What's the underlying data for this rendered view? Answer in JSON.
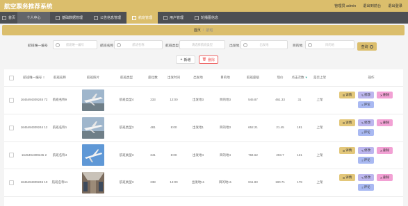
{
  "app": {
    "title": "航空票务推荐系统",
    "user": "管理员 admin",
    "logout": "退出到前台",
    "exit": "退出登录"
  },
  "nav": [
    {
      "label": "首页"
    },
    {
      "label": "个人中心"
    },
    {
      "label": "基础数据管理"
    },
    {
      "label": "公告信息管理"
    },
    {
      "label": "航班管理"
    },
    {
      "label": "用户管理"
    },
    {
      "label": "轮播图信息"
    }
  ],
  "breadcrumb": {
    "home": "首页",
    "sep": "/",
    "current": "航班"
  },
  "search": {
    "fields": [
      {
        "label": "航班唯一编号",
        "placeholder": "航班唯一编号"
      },
      {
        "label": "航班名称",
        "placeholder": "航班名称"
      },
      {
        "label": "航班类型",
        "placeholder": "请选择航班类型"
      },
      {
        "label": "出发地",
        "placeholder": "出发地"
      },
      {
        "label": "目的地",
        "placeholder": "目的地"
      }
    ],
    "query": "查询"
  },
  "actions": {
    "add": "新增",
    "delete": "删除"
  },
  "table": {
    "headers": [
      "航班唯一编号",
      "航班名称",
      "航班照片",
      "航班类型",
      "座位数",
      "出发时间",
      "出发地",
      "目的地",
      "航班座级",
      "现价",
      "点击次数",
      "是否上架",
      "操作"
    ],
    "rows": [
      {
        "id": "1645494309245 72",
        "name": "航班名称9",
        "type": "航班类型4",
        "seats": "233",
        "time": "12:00",
        "from": "出发地3",
        "to": "目的地3",
        "grade": "545.87",
        "price": "461.33",
        "clicks": "31",
        "status": "上架",
        "plane": "white"
      },
      {
        "id": "1645494309244 12",
        "name": "航班名称1",
        "type": "航班类型3",
        "seats": "481",
        "time": "8:00",
        "from": "出发地1",
        "to": "目的地3",
        "grade": "652.21",
        "price": "21.45",
        "clicks": "191",
        "status": "上架",
        "plane": "white"
      },
      {
        "id": "1645494309245 2",
        "name": "航班名称4",
        "type": "航班类型3",
        "seats": "341",
        "time": "8:00",
        "from": "出发地4",
        "to": "目的地4",
        "grade": "784.62",
        "price": "293.7",
        "clicks": "121",
        "status": "上架",
        "plane": "blue"
      },
      {
        "id": "1645494309245 10",
        "name": "航班名称11",
        "type": "航班类型3",
        "seats": "238",
        "time": "14:00",
        "from": "出发地11",
        "to": "目的地11",
        "grade": "811.83",
        "price": "190.71",
        "clicks": "179",
        "status": "上架",
        "plane": "cabin"
      }
    ],
    "ops": {
      "detail": "详情",
      "edit": "修改",
      "remove": "删除",
      "reviews": "评论"
    }
  },
  "colors": {
    "accent": "#dbbe6c",
    "nav_bg": "#4d4f53",
    "detail": "#e3c77a",
    "edit": "#bcb6ee",
    "remove": "#f2a1d4",
    "reviews": "#a9b9f2"
  }
}
